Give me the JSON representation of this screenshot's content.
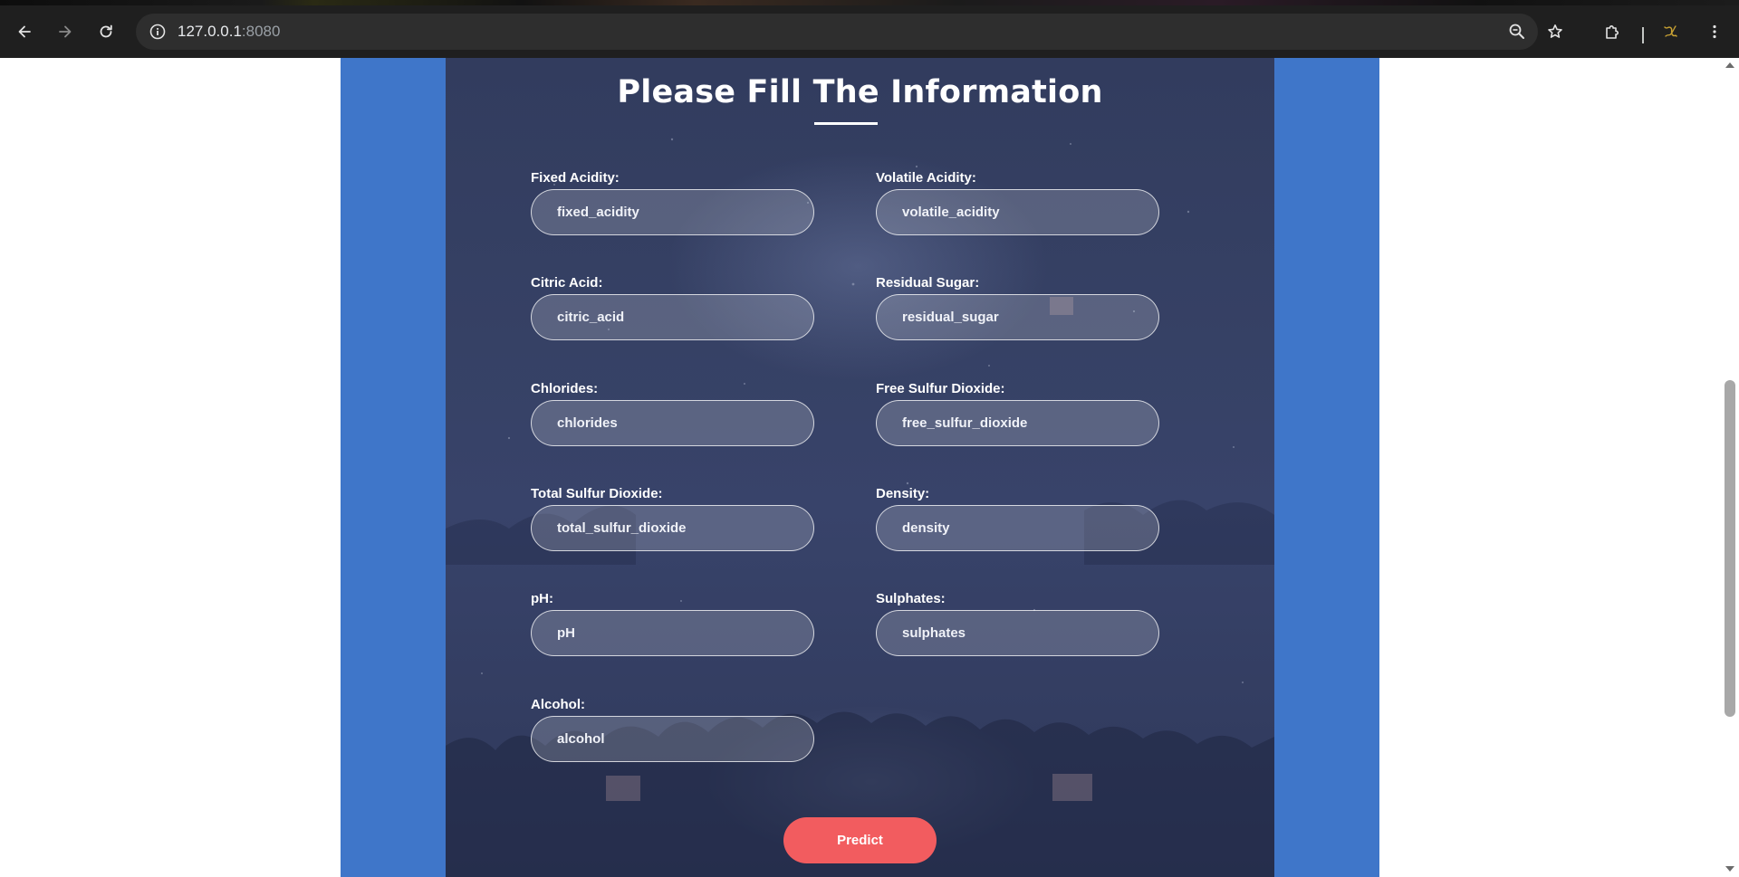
{
  "browser": {
    "url_host": "127.0.0.1",
    "url_port": ":8080",
    "icons": {
      "back": "back-arrow-icon",
      "forward": "forward-arrow-icon",
      "reload": "reload-icon",
      "site_info": "info-icon",
      "zoom": "zoom-icon",
      "bookmark": "star-icon",
      "extensions": "puzzle-icon",
      "profile": "profile-icon",
      "menu": "kebab-menu-icon"
    }
  },
  "page": {
    "title": "Please Fill The Information",
    "colors": {
      "band": "#3f76c9",
      "panel": "#363f63",
      "button": "#f25c5f"
    }
  },
  "form": {
    "fields": [
      {
        "label": "Fixed Acidity:",
        "placeholder": "fixed_acidity"
      },
      {
        "label": "Volatile Acidity:",
        "placeholder": "volatile_acidity"
      },
      {
        "label": "Citric Acid:",
        "placeholder": "citric_acid"
      },
      {
        "label": "Residual Sugar:",
        "placeholder": "residual_sugar"
      },
      {
        "label": "Chlorides:",
        "placeholder": "chlorides"
      },
      {
        "label": "Free Sulfur Dioxide:",
        "placeholder": "free_sulfur_dioxide"
      },
      {
        "label": "Total Sulfur Dioxide:",
        "placeholder": "total_sulfur_dioxide"
      },
      {
        "label": "Density:",
        "placeholder": "density"
      },
      {
        "label": "pH:",
        "placeholder": "pH"
      },
      {
        "label": "Sulphates:",
        "placeholder": "sulphates"
      },
      {
        "label": "Alcohol:",
        "placeholder": "alcohol"
      }
    ],
    "submit_label": "Predict"
  }
}
